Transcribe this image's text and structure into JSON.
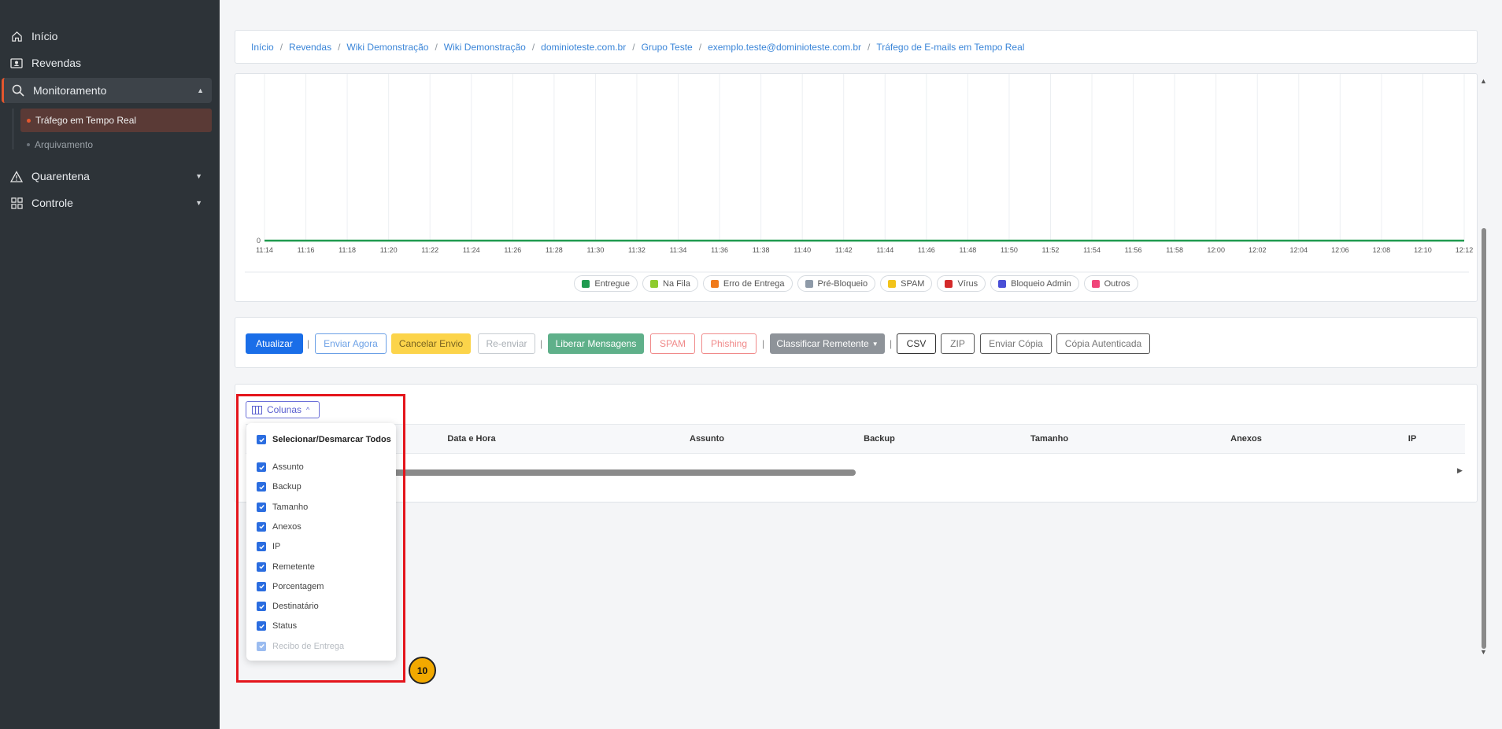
{
  "sidebar": {
    "items": [
      {
        "label": "Início",
        "icon": "home-icon"
      },
      {
        "label": "Revendas",
        "icon": "id-card-icon"
      },
      {
        "label": "Monitoramento",
        "icon": "search-icon"
      },
      {
        "label": "Quarentena",
        "icon": "warning-icon"
      },
      {
        "label": "Controle",
        "icon": "grid-icon"
      }
    ],
    "sub_items": [
      {
        "label": "Tráfego em Tempo Real"
      },
      {
        "label": "Arquivamento"
      }
    ]
  },
  "breadcrumb": [
    "Início",
    "Revendas",
    "Wiki Demonstração",
    "Wiki Demonstração",
    "dominioteste.com.br",
    "Grupo Teste",
    "exemplo.teste@dominioteste.com.br",
    "Tráfego de E-mails em Tempo Real"
  ],
  "chart_data": {
    "type": "line",
    "x": [
      "11:14",
      "11:16",
      "11:18",
      "11:20",
      "11:22",
      "11:24",
      "11:26",
      "11:28",
      "11:30",
      "11:32",
      "11:34",
      "11:36",
      "11:38",
      "11:40",
      "11:42",
      "11:44",
      "11:46",
      "11:48",
      "11:50",
      "11:52",
      "11:54",
      "11:56",
      "11:58",
      "12:00",
      "12:02",
      "12:04",
      "12:06",
      "12:08",
      "12:10",
      "12:12"
    ],
    "y_tick_labels": [
      "0"
    ],
    "series": [
      {
        "name": "Entregue",
        "color": "#1f9a4f",
        "values": [
          0,
          0,
          0,
          0,
          0,
          0,
          0,
          0,
          0,
          0,
          0,
          0,
          0,
          0,
          0,
          0,
          0,
          0,
          0,
          0,
          0,
          0,
          0,
          0,
          0,
          0,
          0,
          0,
          0,
          0
        ]
      }
    ],
    "legend": [
      {
        "label": "Entregue",
        "color": "#1f9a4f"
      },
      {
        "label": "Na Fila",
        "color": "#8ecb2f"
      },
      {
        "label": "Erro de Entrega",
        "color": "#f07a1a"
      },
      {
        "label": "Pré-Bloqueio",
        "color": "#8e9aa8"
      },
      {
        "label": "SPAM",
        "color": "#f2c31a"
      },
      {
        "label": "Vírus",
        "color": "#d42a2a"
      },
      {
        "label": "Bloqueio Admin",
        "color": "#4a4fd6"
      },
      {
        "label": "Outros",
        "color": "#f0457a"
      }
    ],
    "grid": true,
    "legend_position": "bottom"
  },
  "actions": {
    "atualizar": "Atualizar",
    "enviar_agora": "Enviar Agora",
    "cancelar_envio": "Cancelar Envio",
    "re_enviar": "Re-enviar",
    "liberar": "Liberar Mensagens",
    "spam": "SPAM",
    "phishing": "Phishing",
    "classificar": "Classificar Remetente",
    "csv": "CSV",
    "zip": "ZIP",
    "enviar_copia": "Enviar Cópia",
    "copia_autenticada": "Cópia Autenticada",
    "separator": "|"
  },
  "table": {
    "columns_button": "Colunas",
    "headers": [
      "Data e Hora",
      "Assunto",
      "Backup",
      "Tamanho",
      "Anexos",
      "IP"
    ]
  },
  "columns_dropdown": {
    "select_all": "Selecionar/Desmarcar Todos",
    "options": [
      {
        "label": "Assunto",
        "checked": true
      },
      {
        "label": "Backup",
        "checked": true
      },
      {
        "label": "Tamanho",
        "checked": true
      },
      {
        "label": "Anexos",
        "checked": true
      },
      {
        "label": "IP",
        "checked": true
      },
      {
        "label": "Remetente",
        "checked": true
      },
      {
        "label": "Porcentagem",
        "checked": true
      },
      {
        "label": "Destinatário",
        "checked": true
      },
      {
        "label": "Status",
        "checked": true
      },
      {
        "label": "Recibo de Entrega",
        "checked": true,
        "disabled": true
      }
    ]
  },
  "annotation": {
    "step": "10"
  },
  "colors": {
    "accent": "#e4572e",
    "primary": "#1a73e8",
    "highlight": "#e4151c"
  }
}
